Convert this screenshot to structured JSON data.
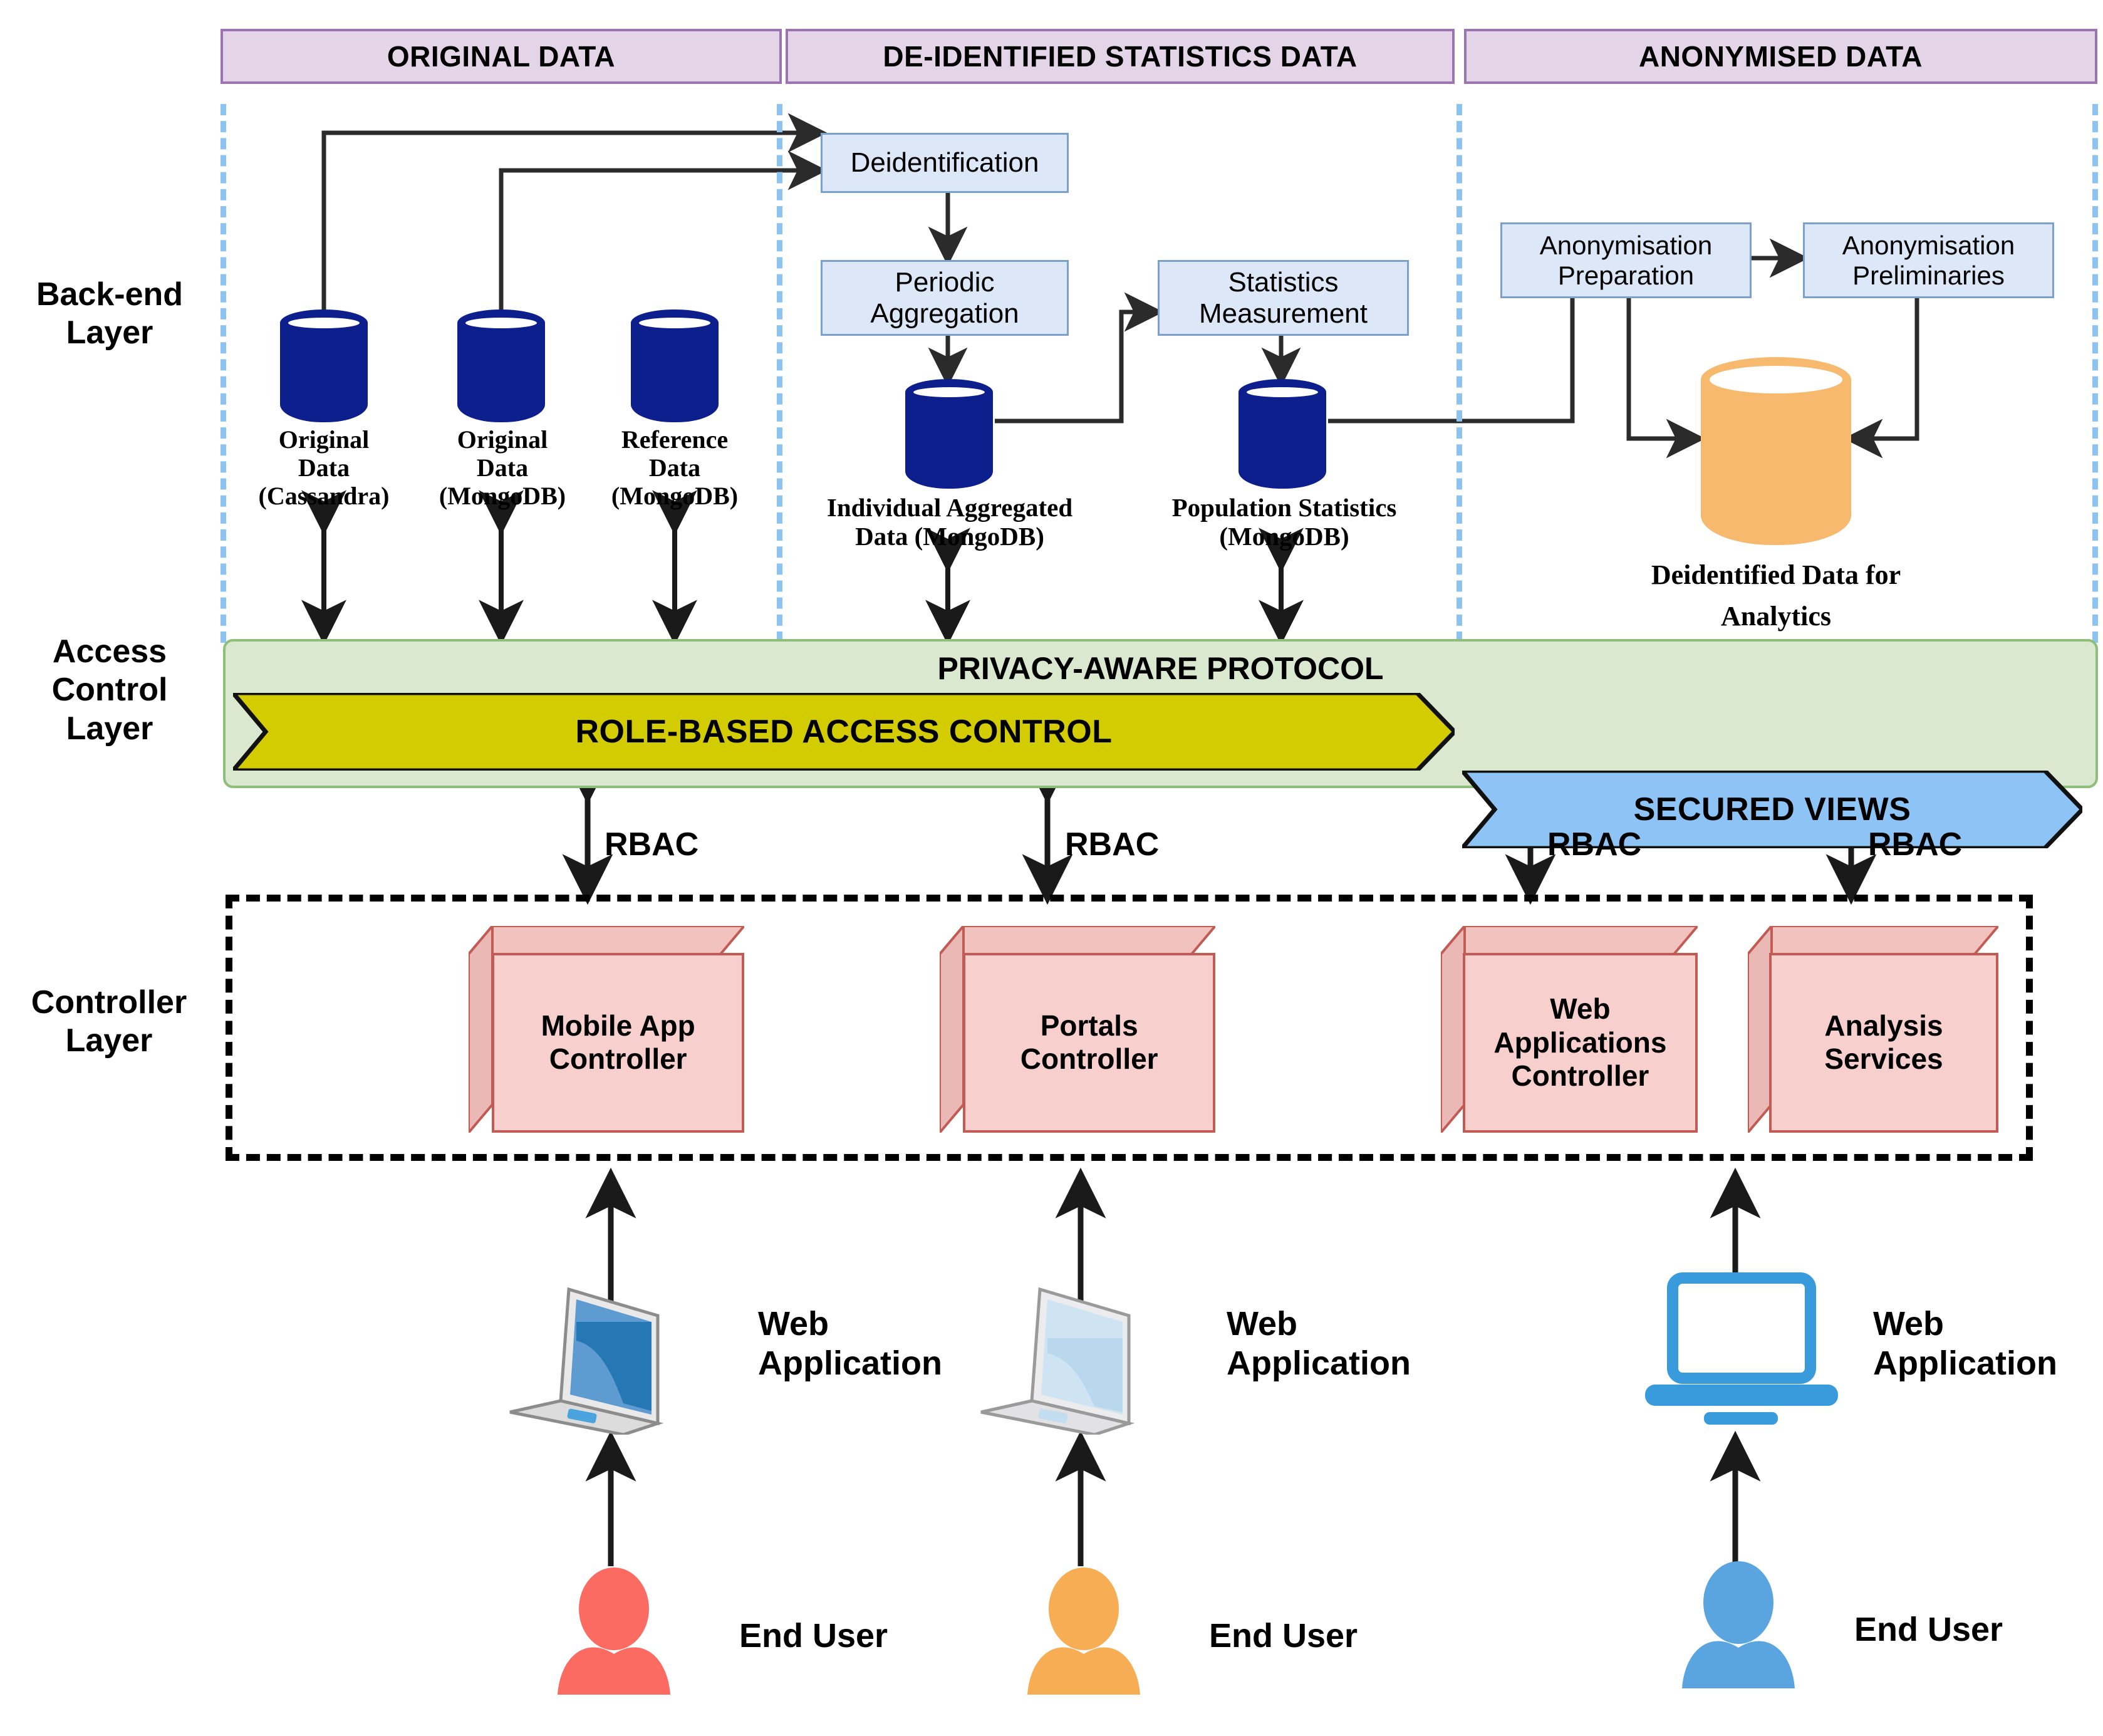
{
  "sections": [
    {
      "id": "original",
      "label": "ORIGINAL DATA"
    },
    {
      "id": "deident",
      "label": "DE-IDENTIFIED STATISTICS DATA"
    },
    {
      "id": "anonymised",
      "label": "ANONYMISED DATA"
    }
  ],
  "layers": [
    {
      "id": "backend",
      "label": "Back-end\nLayer"
    },
    {
      "id": "access",
      "label": "Access\nControl\nLayer"
    },
    {
      "id": "controller",
      "label": "Controller\nLayer"
    }
  ],
  "layer_labels": {
    "backend_line1": "Back-end",
    "backend_line2": "Layer",
    "access_line1": "Access",
    "access_line2": "Control",
    "access_line3": "Layer",
    "controller_line1": "Controller",
    "controller_line2": "Layer"
  },
  "process_boxes": [
    {
      "id": "deidentification",
      "label": "Deidentification"
    },
    {
      "id": "periodic-aggregation",
      "line1": "Periodic",
      "line2": "Aggregation"
    },
    {
      "id": "statistics-measurement",
      "line1": "Statistics",
      "line2": "Measurement"
    },
    {
      "id": "anonymisation-preparation",
      "line1": "Anonymisation",
      "line2": "Preparation"
    },
    {
      "id": "anonymisation-preliminaries",
      "line1": "Anonymisation",
      "line2": "Preliminaries"
    }
  ],
  "datastores": [
    {
      "id": "original-data-cassandra",
      "color": "#0d1f8c",
      "line1": "Original",
      "line2": "Data",
      "line3": "(Cassandra)"
    },
    {
      "id": "original-data-mongodb",
      "color": "#0d1f8c",
      "line1": "Original",
      "line2": "Data",
      "line3": "(MongoDB)"
    },
    {
      "id": "reference-data-mongodb",
      "color": "#0d1f8c",
      "line1": "Reference",
      "line2": "Data",
      "line3": "(MongoDB)"
    },
    {
      "id": "individual-aggregated-data",
      "color": "#0d1f8c",
      "line1": "Individual  Aggregated",
      "line2": "Data (MongoDB)"
    },
    {
      "id": "population-statistics",
      "color": "#0d1f8c",
      "line1": "Population Statistics",
      "line2": "(MongoDB)"
    },
    {
      "id": "deidentified-analytics",
      "color": "#f7b96e",
      "line1": "Deidentified Data for",
      "line2": "Analytics"
    }
  ],
  "access_control": {
    "protocol_label": "PRIVACY-AWARE PROTOCOL",
    "chevrons": [
      {
        "id": "rbac-chevron",
        "label": "ROLE-BASED ACCESS CONTROL",
        "color": "#d2cc00"
      },
      {
        "id": "secured-views-chevron",
        "label": "SECURED VIEWS",
        "color": "#8ec3f5"
      }
    ]
  },
  "rbac_connectors": [
    {
      "id": "rbac-1",
      "label": "RBAC"
    },
    {
      "id": "rbac-2",
      "label": "RBAC"
    },
    {
      "id": "rbac-3",
      "label": "RBAC"
    },
    {
      "id": "rbac-4",
      "label": "RBAC"
    }
  ],
  "controllers": [
    {
      "id": "mobile-app-controller",
      "line1": "Mobile App",
      "line2": "Controller",
      "line3": ""
    },
    {
      "id": "portals-controller",
      "line1": "Portals",
      "line2": "Controller",
      "line3": ""
    },
    {
      "id": "web-applications-controller",
      "line1": "Web",
      "line2": "Applications",
      "line3": "Controller"
    },
    {
      "id": "analysis-services",
      "line1": "Analysis",
      "line2": "Services",
      "line3": ""
    }
  ],
  "clients": [
    {
      "id": "client-1",
      "app_line1": "Web",
      "app_line2": "Application",
      "user_label": "End User",
      "user_color": "#fb6b62",
      "laptop_style": "blue-dark"
    },
    {
      "id": "client-2",
      "app_line1": "Web",
      "app_line2": "Application",
      "user_label": "End User",
      "user_color": "#f7ad54",
      "laptop_style": "blue-pale"
    },
    {
      "id": "client-3",
      "app_line1": "Web",
      "app_line2": "Application",
      "user_label": "End User",
      "user_color": "#5aa5e0",
      "laptop_style": "flat-blue"
    }
  ],
  "colors": {
    "section_header_fill": "#e3d4e8",
    "section_header_border": "#9b74b0",
    "process_fill": "#dce8f7",
    "process_border": "#7ba0cc",
    "db_blue": "#0d1f8c",
    "db_orange": "#f7b96e",
    "acl_band_fill": "#d9e8ce",
    "acl_band_border": "#8fbd7a",
    "rbac_bar": "#d2cc00",
    "secured_views_bar": "#8ec3f5",
    "controller_fill": "#f7cfcc",
    "controller_border": "#c25b54",
    "divider_blue": "#8dc3f0"
  }
}
